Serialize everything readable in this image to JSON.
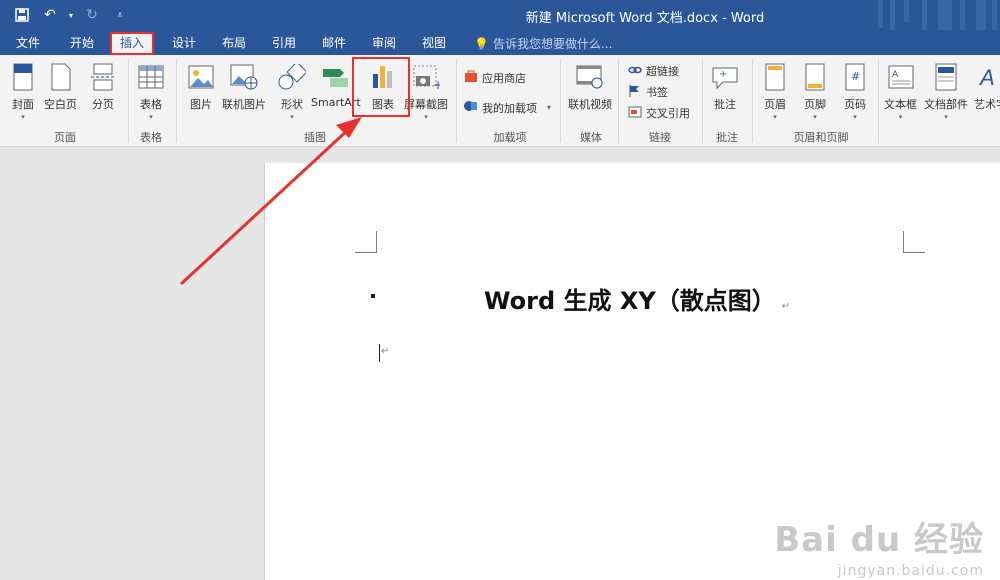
{
  "window": {
    "title": "新建 Microsoft Word 文档.docx - Word"
  },
  "qat": {
    "save_icon": "save-icon",
    "undo_icon": "undo-icon",
    "redo_icon": "redo-icon",
    "customize_icon": "customize-icon"
  },
  "tabs": [
    {
      "label": "文件"
    },
    {
      "label": "开始"
    },
    {
      "label": "插入"
    },
    {
      "label": "设计"
    },
    {
      "label": "布局"
    },
    {
      "label": "引用"
    },
    {
      "label": "邮件"
    },
    {
      "label": "审阅"
    },
    {
      "label": "视图"
    }
  ],
  "tell_me": {
    "placeholder": "告诉我您想要做什么..."
  },
  "ribbon": {
    "pages": {
      "cover": "封面",
      "blank": "空白页",
      "break": "分页",
      "group": "页面"
    },
    "tables": {
      "table": "表格",
      "group": "表格"
    },
    "illustrations": {
      "picture": "图片",
      "online_picture": "联机图片",
      "shapes": "形状",
      "smartart": "SmartArt",
      "chart": "图表",
      "screenshot": "屏幕截图",
      "group": "插图"
    },
    "addins": {
      "store": "应用商店",
      "my_addins": "我的加载项",
      "group": "加载项"
    },
    "media": {
      "online_video": "联机视频",
      "group": "媒体"
    },
    "links": {
      "hyperlink": "超链接",
      "bookmark": "书签",
      "cross_ref": "交叉引用",
      "group": "链接"
    },
    "comments": {
      "comment": "批注",
      "group": "批注"
    },
    "header_footer": {
      "header": "页眉",
      "footer": "页脚",
      "page_number": "页码",
      "group": "页眉和页脚"
    },
    "text": {
      "textbox": "文本框",
      "quick_parts": "文档部件",
      "wordart": "艺术字"
    }
  },
  "document": {
    "heading": "Word 生成 XY（散点图）",
    "para_mark": "↵"
  },
  "watermark": {
    "main": "Bai du 经验",
    "sub": "jingyan.baidu.com"
  },
  "colors": {
    "accent": "#2b579a",
    "highlight": "#e8302f"
  }
}
